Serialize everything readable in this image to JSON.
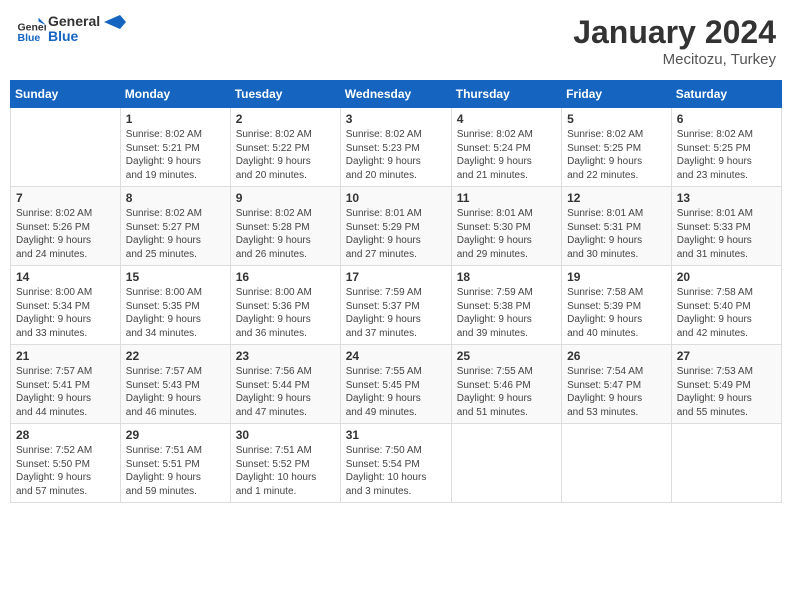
{
  "header": {
    "logo_general": "General",
    "logo_blue": "Blue",
    "month_title": "January 2024",
    "location": "Mecitozu, Turkey"
  },
  "weekdays": [
    "Sunday",
    "Monday",
    "Tuesday",
    "Wednesday",
    "Thursday",
    "Friday",
    "Saturday"
  ],
  "weeks": [
    [
      {
        "day": "",
        "info": ""
      },
      {
        "day": "1",
        "info": "Sunrise: 8:02 AM\nSunset: 5:21 PM\nDaylight: 9 hours\nand 19 minutes."
      },
      {
        "day": "2",
        "info": "Sunrise: 8:02 AM\nSunset: 5:22 PM\nDaylight: 9 hours\nand 20 minutes."
      },
      {
        "day": "3",
        "info": "Sunrise: 8:02 AM\nSunset: 5:23 PM\nDaylight: 9 hours\nand 20 minutes."
      },
      {
        "day": "4",
        "info": "Sunrise: 8:02 AM\nSunset: 5:24 PM\nDaylight: 9 hours\nand 21 minutes."
      },
      {
        "day": "5",
        "info": "Sunrise: 8:02 AM\nSunset: 5:25 PM\nDaylight: 9 hours\nand 22 minutes."
      },
      {
        "day": "6",
        "info": "Sunrise: 8:02 AM\nSunset: 5:25 PM\nDaylight: 9 hours\nand 23 minutes."
      }
    ],
    [
      {
        "day": "7",
        "info": "Sunrise: 8:02 AM\nSunset: 5:26 PM\nDaylight: 9 hours\nand 24 minutes."
      },
      {
        "day": "8",
        "info": "Sunrise: 8:02 AM\nSunset: 5:27 PM\nDaylight: 9 hours\nand 25 minutes."
      },
      {
        "day": "9",
        "info": "Sunrise: 8:02 AM\nSunset: 5:28 PM\nDaylight: 9 hours\nand 26 minutes."
      },
      {
        "day": "10",
        "info": "Sunrise: 8:01 AM\nSunset: 5:29 PM\nDaylight: 9 hours\nand 27 minutes."
      },
      {
        "day": "11",
        "info": "Sunrise: 8:01 AM\nSunset: 5:30 PM\nDaylight: 9 hours\nand 29 minutes."
      },
      {
        "day": "12",
        "info": "Sunrise: 8:01 AM\nSunset: 5:31 PM\nDaylight: 9 hours\nand 30 minutes."
      },
      {
        "day": "13",
        "info": "Sunrise: 8:01 AM\nSunset: 5:33 PM\nDaylight: 9 hours\nand 31 minutes."
      }
    ],
    [
      {
        "day": "14",
        "info": "Sunrise: 8:00 AM\nSunset: 5:34 PM\nDaylight: 9 hours\nand 33 minutes."
      },
      {
        "day": "15",
        "info": "Sunrise: 8:00 AM\nSunset: 5:35 PM\nDaylight: 9 hours\nand 34 minutes."
      },
      {
        "day": "16",
        "info": "Sunrise: 8:00 AM\nSunset: 5:36 PM\nDaylight: 9 hours\nand 36 minutes."
      },
      {
        "day": "17",
        "info": "Sunrise: 7:59 AM\nSunset: 5:37 PM\nDaylight: 9 hours\nand 37 minutes."
      },
      {
        "day": "18",
        "info": "Sunrise: 7:59 AM\nSunset: 5:38 PM\nDaylight: 9 hours\nand 39 minutes."
      },
      {
        "day": "19",
        "info": "Sunrise: 7:58 AM\nSunset: 5:39 PM\nDaylight: 9 hours\nand 40 minutes."
      },
      {
        "day": "20",
        "info": "Sunrise: 7:58 AM\nSunset: 5:40 PM\nDaylight: 9 hours\nand 42 minutes."
      }
    ],
    [
      {
        "day": "21",
        "info": "Sunrise: 7:57 AM\nSunset: 5:41 PM\nDaylight: 9 hours\nand 44 minutes."
      },
      {
        "day": "22",
        "info": "Sunrise: 7:57 AM\nSunset: 5:43 PM\nDaylight: 9 hours\nand 46 minutes."
      },
      {
        "day": "23",
        "info": "Sunrise: 7:56 AM\nSunset: 5:44 PM\nDaylight: 9 hours\nand 47 minutes."
      },
      {
        "day": "24",
        "info": "Sunrise: 7:55 AM\nSunset: 5:45 PM\nDaylight: 9 hours\nand 49 minutes."
      },
      {
        "day": "25",
        "info": "Sunrise: 7:55 AM\nSunset: 5:46 PM\nDaylight: 9 hours\nand 51 minutes."
      },
      {
        "day": "26",
        "info": "Sunrise: 7:54 AM\nSunset: 5:47 PM\nDaylight: 9 hours\nand 53 minutes."
      },
      {
        "day": "27",
        "info": "Sunrise: 7:53 AM\nSunset: 5:49 PM\nDaylight: 9 hours\nand 55 minutes."
      }
    ],
    [
      {
        "day": "28",
        "info": "Sunrise: 7:52 AM\nSunset: 5:50 PM\nDaylight: 9 hours\nand 57 minutes."
      },
      {
        "day": "29",
        "info": "Sunrise: 7:51 AM\nSunset: 5:51 PM\nDaylight: 9 hours\nand 59 minutes."
      },
      {
        "day": "30",
        "info": "Sunrise: 7:51 AM\nSunset: 5:52 PM\nDaylight: 10 hours\nand 1 minute."
      },
      {
        "day": "31",
        "info": "Sunrise: 7:50 AM\nSunset: 5:54 PM\nDaylight: 10 hours\nand 3 minutes."
      },
      {
        "day": "",
        "info": ""
      },
      {
        "day": "",
        "info": ""
      },
      {
        "day": "",
        "info": ""
      }
    ]
  ]
}
